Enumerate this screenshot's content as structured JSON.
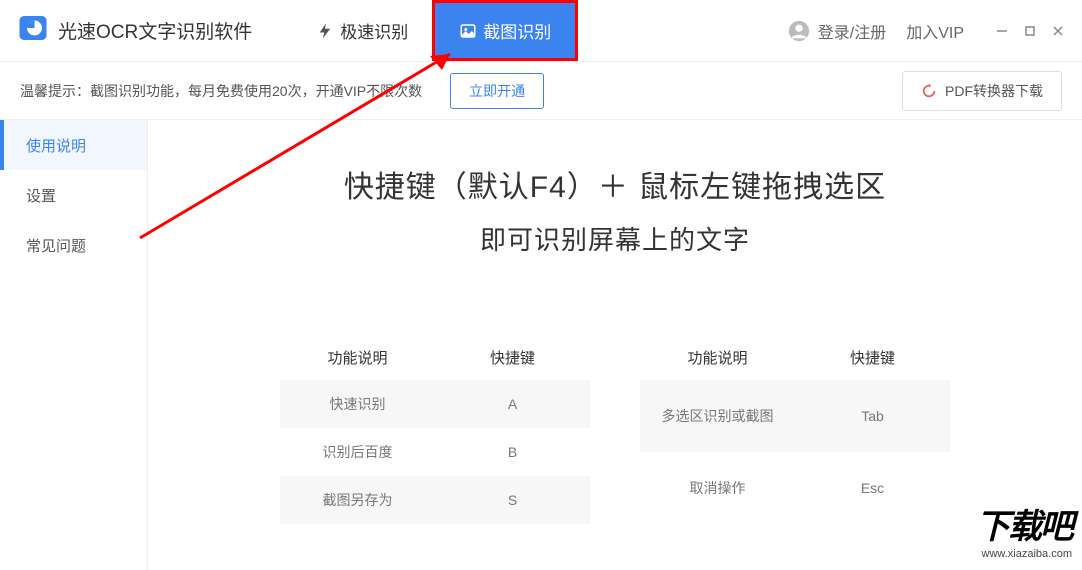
{
  "header": {
    "title": "光速OCR文字识别软件",
    "tabs": [
      {
        "label": "极速识别",
        "active": false
      },
      {
        "label": "截图识别",
        "active": true
      }
    ],
    "login_label": "登录/注册",
    "vip_label": "加入VIP"
  },
  "subheader": {
    "tip": "温馨提示：截图识别功能，每月免费使用20次，开通VIP不限次数",
    "open_label": "立即开通",
    "pdf_label": "PDF转换器下载"
  },
  "sidebar": {
    "items": [
      {
        "label": "使用说明",
        "active": true
      },
      {
        "label": "设置",
        "active": false
      },
      {
        "label": "常见问题",
        "active": false
      }
    ]
  },
  "main": {
    "heading1": "快捷键（默认F4）＋ 鼠标左键拖拽选区",
    "heading2": "即可识别屏幕上的文字",
    "table_headers": [
      "功能说明",
      "快捷键"
    ],
    "left_table": [
      {
        "desc": "快速识别",
        "key": "A"
      },
      {
        "desc": "识别后百度",
        "key": "B"
      },
      {
        "desc": "截图另存为",
        "key": "S"
      }
    ],
    "right_table": [
      {
        "desc": "多选区识别或截图",
        "key": "Tab"
      },
      {
        "desc": "取消操作",
        "key": "Esc"
      }
    ]
  },
  "watermark": {
    "logo": "下载吧",
    "url": "www.xiazaiba.com"
  }
}
